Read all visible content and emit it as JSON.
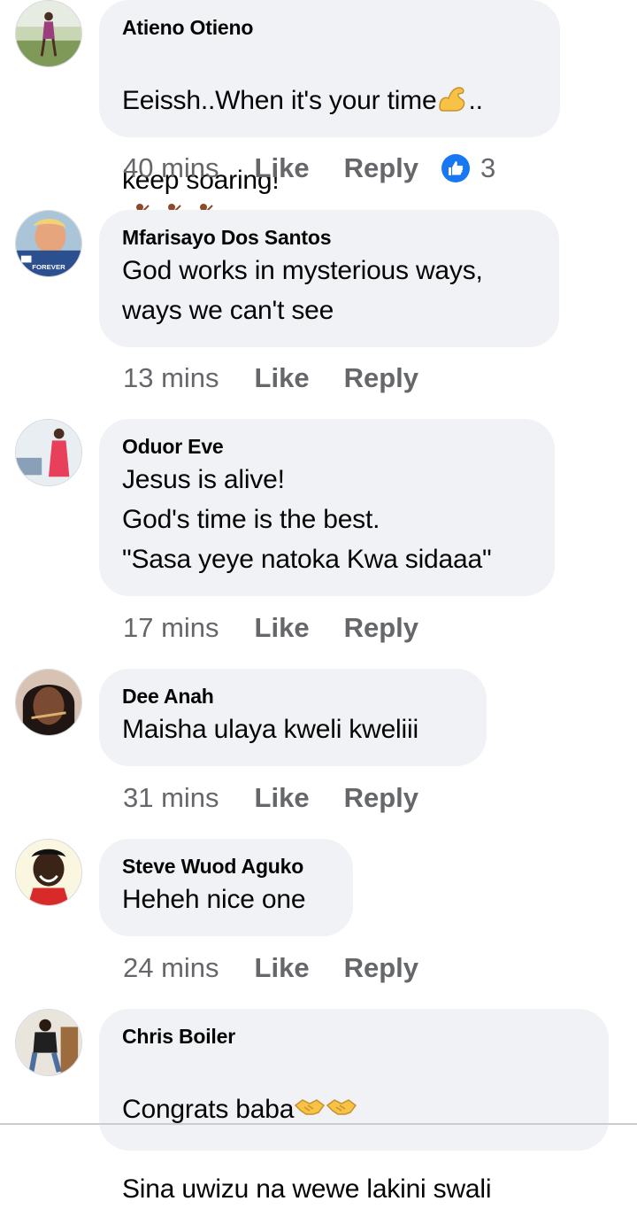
{
  "comments": [
    {
      "author": "Atieno Otieno",
      "text_1": "Eeissh..When it's your time",
      "text_1b": "..",
      "text_2": "keep soaring!",
      "time": "40 mins",
      "like": "Like",
      "reply": "Reply",
      "reaction_count": "3"
    },
    {
      "author": "Mfarisayo Dos Santos",
      "text": "God works in mysterious ways,\nways we can't see",
      "time": "13 mins",
      "like": "Like",
      "reply": "Reply",
      "avatar_caption": "FOREVER"
    },
    {
      "author": "Oduor Eve",
      "text": "Jesus is alive!\nGod's time is the best.\n\"Sasa yeye natoka Kwa sidaaa\"",
      "time": "17 mins",
      "like": "Like",
      "reply": "Reply"
    },
    {
      "author": "Dee Anah",
      "text": "Maisha ulaya kweli kweliii",
      "time": "31 mins",
      "like": "Like",
      "reply": "Reply"
    },
    {
      "author": "Steve Wuod Aguko",
      "text": "Heheh nice one",
      "time": "24 mins",
      "like": "Like",
      "reply": "Reply"
    },
    {
      "author": "Chris Boiler",
      "text_1": "Congrats baba",
      "text_2": "Sina uwizu na wewe lakini swali"
    }
  ]
}
